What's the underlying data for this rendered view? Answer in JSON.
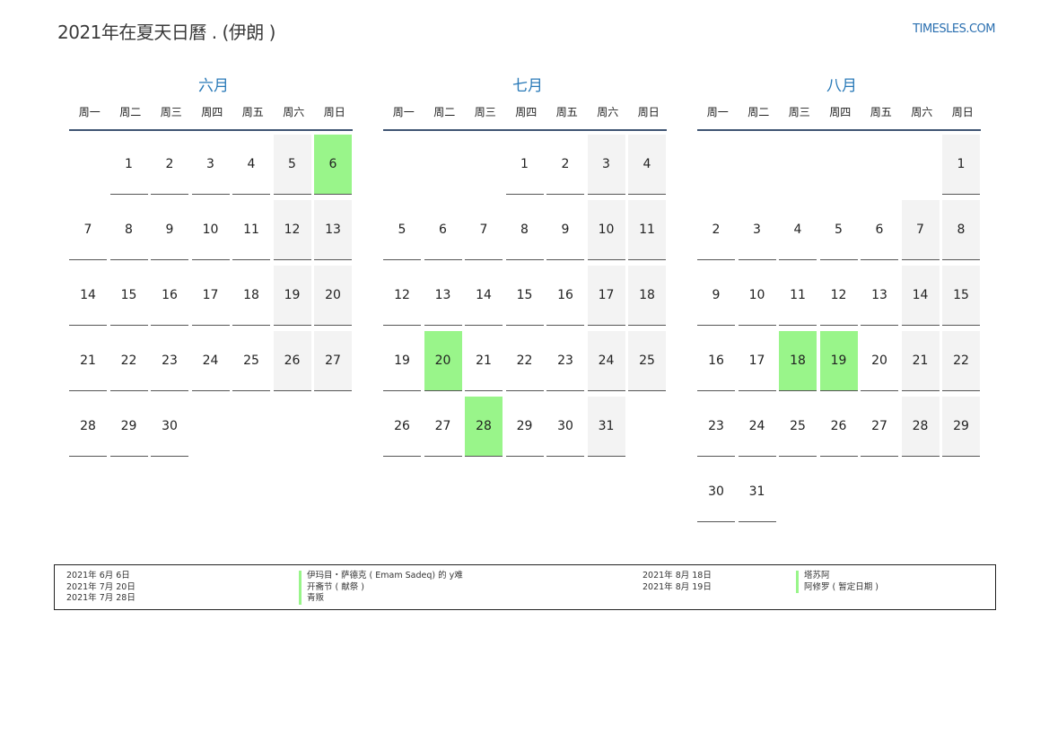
{
  "header": {
    "title": "2021年在夏天日曆 . (伊朗 )",
    "brand": "TIMESLES.COM"
  },
  "weekday_labels": [
    "周一",
    "周二",
    "周三",
    "周四",
    "周五",
    "周六",
    "周日"
  ],
  "colors": {
    "accent": "#2a7ab8",
    "holiday": "#99f58a",
    "weekend": "#f3f3f3",
    "rule": "#3f5573"
  },
  "months": [
    {
      "name": "六月",
      "offset": 1,
      "days": 30,
      "holidays": [
        6
      ]
    },
    {
      "name": "七月",
      "offset": 3,
      "days": 31,
      "holidays": [
        20,
        28
      ]
    },
    {
      "name": "八月",
      "offset": 6,
      "days": 31,
      "holidays": [
        18,
        19
      ]
    }
  ],
  "legend": {
    "left": [
      {
        "date": "2021年 6月 6日",
        "event": "伊玛目・萨德克 ( Emam Sadeq) 的 y难"
      },
      {
        "date": "2021年 7月 20日",
        "event": "开斋节 ( 献祭 )"
      },
      {
        "date": "2021年 7月 28日",
        "event": "青叛"
      }
    ],
    "right": [
      {
        "date": "2021年 8月 18日",
        "event": "塔苏阿"
      },
      {
        "date": "2021年 8月 19日",
        "event": "阿修罗 ( 暂定日期 )"
      }
    ]
  }
}
